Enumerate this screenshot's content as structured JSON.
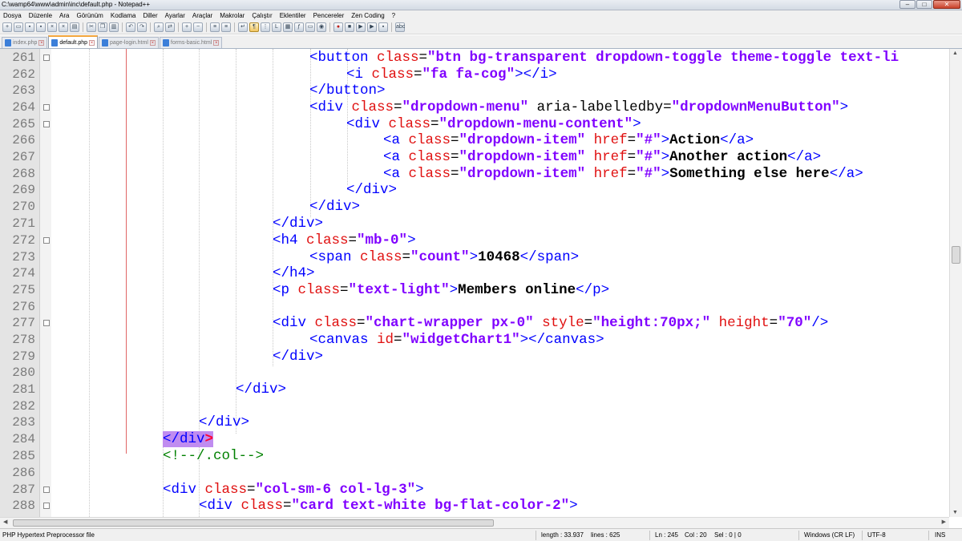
{
  "window": {
    "title": "C:\\wamp64\\www\\admin\\inc\\default.php - Notepad++",
    "buttons": {
      "minimize": "–",
      "maximize": "□",
      "close": "✕"
    }
  },
  "menu": [
    "Dosya",
    "Düzenle",
    "Ara",
    "Görünüm",
    "Kodlama",
    "Diller",
    "Ayarlar",
    "Araçlar",
    "Makrolar",
    "Çalıştır",
    "Eklentiler",
    "Pencereler",
    "Zen Coding",
    "?"
  ],
  "tabs": [
    {
      "label": "index.php",
      "active": false
    },
    {
      "label": "default.php",
      "active": true
    },
    {
      "label": "page-login.html",
      "active": false
    },
    {
      "label": "forms-basic.html",
      "active": false
    }
  ],
  "editor": {
    "lines": [
      {
        "n": "261",
        "fold": true
      },
      {
        "n": "262"
      },
      {
        "n": "263"
      },
      {
        "n": "264",
        "fold": true
      },
      {
        "n": "265",
        "fold": true
      },
      {
        "n": "266"
      },
      {
        "n": "267"
      },
      {
        "n": "268"
      },
      {
        "n": "269"
      },
      {
        "n": "270"
      },
      {
        "n": "271"
      },
      {
        "n": "272",
        "fold": true
      },
      {
        "n": "273"
      },
      {
        "n": "274"
      },
      {
        "n": "275"
      },
      {
        "n": "276"
      },
      {
        "n": "277",
        "fold": true
      },
      {
        "n": "278"
      },
      {
        "n": "279"
      },
      {
        "n": "280"
      },
      {
        "n": "281"
      },
      {
        "n": "282"
      },
      {
        "n": "283"
      },
      {
        "n": "284"
      },
      {
        "n": "285"
      },
      {
        "n": "286"
      },
      {
        "n": "287",
        "fold": true
      },
      {
        "n": "288",
        "fold": true
      }
    ],
    "code": {
      "l261": {
        "open": "<button ",
        "attr1": "class",
        "eq1": "=",
        "val1": "\"btn bg-transparent dropdown-toggle theme-toggle text-li"
      },
      "l262": {
        "open": "<i ",
        "attr1": "class",
        "eq1": "=",
        "val1": "\"fa fa-cog\"",
        "close": "></i>"
      },
      "l263": {
        "close": "</button>"
      },
      "l264": {
        "open": "<div ",
        "attr1": "class",
        "eq1": "=",
        "val1": "\"dropdown-menu\"",
        "attr2": " aria-labelledby",
        "eq2": "=",
        "val2": "\"dropdownMenuButton\"",
        "close": ">"
      },
      "l265": {
        "open": "<div ",
        "attr1": "class",
        "eq1": "=",
        "val1": "\"dropdown-menu-content\"",
        "close": ">"
      },
      "l266": {
        "open": "<a ",
        "attr1": "class",
        "eq1": "=",
        "val1": "\"dropdown-item\"",
        "attr2": " href",
        "eq2": "=",
        "val2": "\"#\"",
        "gt": ">",
        "text": "Action",
        "close": "</a>"
      },
      "l267": {
        "open": "<a ",
        "attr1": "class",
        "eq1": "=",
        "val1": "\"dropdown-item\"",
        "attr2": " href",
        "eq2": "=",
        "val2": "\"#\"",
        "gt": ">",
        "text": "Another action",
        "close": "</a>"
      },
      "l268": {
        "open": "<a ",
        "attr1": "class",
        "eq1": "=",
        "val1": "\"dropdown-item\"",
        "attr2": " href",
        "eq2": "=",
        "val2": "\"#\"",
        "gt": ">",
        "text": "Something else here",
        "close": "</a>"
      },
      "l269": {
        "close": "</div>"
      },
      "l270": {
        "close": "</div>"
      },
      "l271": {
        "close": "</div>"
      },
      "l272": {
        "open": "<h4 ",
        "attr1": "class",
        "eq1": "=",
        "val1": "\"mb-0\"",
        "close": ">"
      },
      "l273": {
        "open": "<span ",
        "attr1": "class",
        "eq1": "=",
        "val1": "\"count\"",
        "gt": ">",
        "text": "10468",
        "close": "</span>"
      },
      "l274": {
        "close": "</h4>"
      },
      "l275": {
        "open": "<p ",
        "attr1": "class",
        "eq1": "=",
        "val1": "\"text-light\"",
        "gt": ">",
        "text": "Members online",
        "close": "</p>"
      },
      "l277": {
        "open": "<div ",
        "attr1": "class",
        "eq1": "=",
        "val1": "\"chart-wrapper px-0\"",
        "attr2": " style",
        "eq2": "=",
        "val2": "\"height:70px;\"",
        "attr3": " height",
        "eq3": "=",
        "val3": "\"70\"",
        "close": "/>"
      },
      "l278": {
        "open": "<canvas ",
        "attr1": "id",
        "eq1": "=",
        "val1": "\"widgetChart1\"",
        "close": "></canvas>"
      },
      "l279": {
        "close": "</div>"
      },
      "l281": {
        "close": "</div>"
      },
      "l283": {
        "close": "</div>"
      },
      "l284": {
        "open": "</div",
        "close": ">"
      },
      "l285": {
        "comment": "<!--/.col-->"
      },
      "l287": {
        "open": "<div ",
        "attr1": "class",
        "eq1": "=",
        "val1": "\"col-sm-6 col-lg-3\"",
        "close": ">"
      },
      "l288": {
        "open": "<div ",
        "attr1": "class",
        "eq1": "=",
        "val1": "\"card text-white bg-flat-color-2\"",
        "close": ">"
      }
    }
  },
  "status": {
    "file_type": "PHP Hypertext Preprocessor file",
    "length": "length : 33.937",
    "lines": "lines : 625",
    "ln": "Ln : 245",
    "col": "Col : 20",
    "sel": "Sel : 0 | 0",
    "eol": "Windows (CR LF)",
    "encoding": "UTF-8",
    "mode": "INS"
  },
  "colors": {
    "tag": "#0000ff",
    "attribute": "#e01010",
    "value": "#8000ff",
    "comment": "#008000",
    "match_highlight": "#c08cf0",
    "line_number": "#7a7a7a"
  }
}
